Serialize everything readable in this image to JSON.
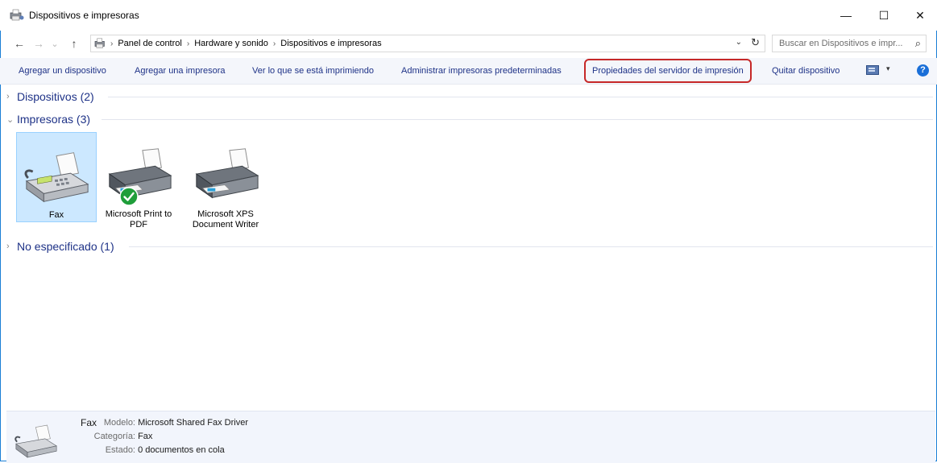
{
  "window": {
    "title": "Dispositivos e impresoras",
    "minimize_label": "—",
    "maximize_label": "☐",
    "close_label": "✕"
  },
  "address": {
    "back_glyph": "←",
    "forward_glyph": "→",
    "recent_glyph": "⌄",
    "up_glyph": "↑",
    "breadcrumb": [
      "Panel de control",
      "Hardware y sonido",
      "Dispositivos e impresoras"
    ],
    "separator": "›",
    "dropdown_glyph": "⌄",
    "refresh_glyph": "↻"
  },
  "search": {
    "placeholder": "Buscar en Dispositivos e impr...",
    "icon_glyph": "⌕"
  },
  "commands": {
    "add_device": "Agregar un dispositivo",
    "add_printer": "Agregar una impresora",
    "see_printing": "Ver lo que se está imprimiendo",
    "manage_default": "Administrar impresoras predeterminadas",
    "print_server_properties": "Propiedades del servidor de impresión",
    "remove_device": "Quitar dispositivo",
    "view_arrow": "▾",
    "help_glyph": "?"
  },
  "groups": {
    "devices": {
      "label": "Dispositivos (2)",
      "chevron": "›"
    },
    "printers": {
      "label": "Impresoras (3)",
      "chevron": "⌄"
    },
    "unspecified": {
      "label": "No especificado (1)",
      "chevron": "›"
    }
  },
  "printers": [
    {
      "name": "Fax",
      "selected": true,
      "icon": "fax-icon"
    },
    {
      "name_line1": "Microsoft Print to",
      "name_line2": "PDF",
      "default": true,
      "icon": "printer-icon"
    },
    {
      "name_line1": "Microsoft XPS",
      "name_line2": "Document Writer",
      "icon": "printer-icon"
    }
  ],
  "details": {
    "name": "Fax",
    "model_key": "Modelo:",
    "model_value": "Microsoft Shared Fax Driver",
    "category_key": "Categoría:",
    "category_value": "Fax",
    "state_key": "Estado:",
    "state_value": "0 documentos en cola"
  },
  "colors": {
    "accent": "#1a7fd6",
    "command_text": "#1e3287",
    "highlight_box": "#c62828",
    "selected_tile": "#cce8ff",
    "default_check": "#1f9e3a"
  }
}
